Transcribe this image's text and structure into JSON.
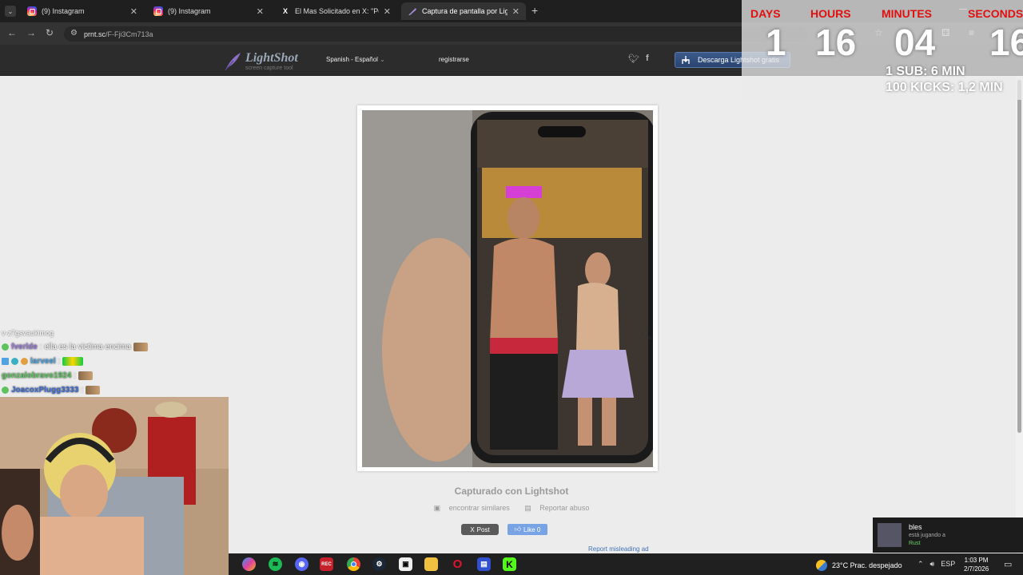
{
  "browser": {
    "tabs": [
      {
        "title": "(9) Instagram",
        "icon": "instagram-icon",
        "active": false
      },
      {
        "title": "(9) Instagram",
        "icon": "instagram-icon",
        "active": false
      },
      {
        "title": "El Mas Solicitado en X: \"Pedofi",
        "icon": "x-icon",
        "active": false
      },
      {
        "title": "Captura de pantalla por Lightsh",
        "icon": "lightshot-icon",
        "active": true
      }
    ],
    "new_tab": "+",
    "url_host": "prnt.sc",
    "url_path": "/F-Fji3Cm713a"
  },
  "lightshot": {
    "logo_name": "LightShot",
    "logo_tag": "screen capture tool",
    "language": "Spanish - Español",
    "register": "registrarse",
    "download": "Descarga Lightshot gratis",
    "captured": "Capturado con Lightshot",
    "find_similar": "encontrar similares",
    "report_abuse": "Reportar abuso",
    "post": "Post",
    "like": "Like 0",
    "report_ad": "Report misleading ad"
  },
  "timer": {
    "labels": [
      "DAYS",
      "HOURS",
      "MINUTES",
      "SECONDS"
    ],
    "values": [
      "1",
      "16",
      "04",
      "16"
    ],
    "rule1": "1 SUB: 6 MIN",
    "rule2": "100 KICKS: 1,2 MIN"
  },
  "chat": {
    "header": "v-z7gsvaukimog",
    "messages": [
      {
        "user": "fverlde",
        "text": ": ella es la victima encima",
        "color": "#9b7bd6"
      },
      {
        "user": "larveel",
        "text": ":",
        "color": "#4fa3e0"
      },
      {
        "user": "gonzalobravo1924",
        "text": ":",
        "color": "#5ec25e"
      },
      {
        "user": "JoacoxPlugg3333",
        "text": ":",
        "color": "#3b6bd6"
      }
    ]
  },
  "notification": {
    "name": "bles",
    "status": "está jugando a",
    "game": "Rust"
  },
  "taskbar": {
    "weather": "23°C  Prac. despejado",
    "lang": "ESP",
    "time": "1:03 PM",
    "date": "2/7/2026"
  },
  "colors": {
    "accent_red": "#e01010",
    "lightshot_header": "#2c2c2c",
    "download_button": "#2a4470"
  }
}
